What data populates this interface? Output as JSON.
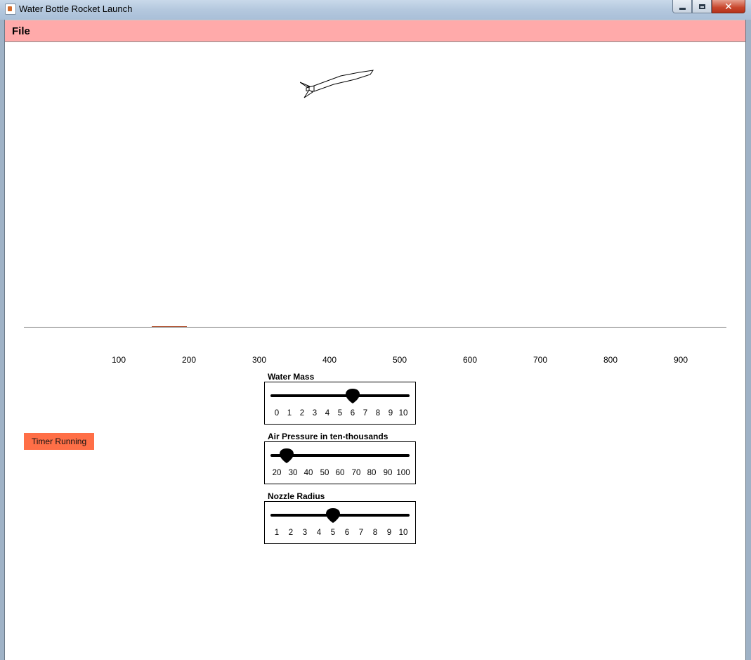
{
  "window": {
    "title": "Water Bottle Rocket Launch"
  },
  "menu": {
    "file_label": "File"
  },
  "axis": {
    "ticks": [
      "100",
      "200",
      "300",
      "400",
      "500",
      "600",
      "700",
      "800",
      "900"
    ]
  },
  "timer": {
    "label": "Timer Running",
    "color": "#ff6f47"
  },
  "sliders": [
    {
      "label": "Water Mass",
      "ticks": [
        "0",
        "1",
        "2",
        "3",
        "4",
        "5",
        "6",
        "7",
        "8",
        "9",
        "10"
      ],
      "value": "6"
    },
    {
      "label": "Air Pressure in ten-thousands",
      "ticks": [
        "20",
        "30",
        "40",
        "50",
        "60",
        "70",
        "80",
        "90",
        "100"
      ],
      "value": "30"
    },
    {
      "label": "Nozzle Radius",
      "ticks": [
        "1",
        "2",
        "3",
        "4",
        "5",
        "6",
        "7",
        "8",
        "9",
        "10"
      ],
      "value": "5"
    }
  ],
  "colors": {
    "menubar": "#ffaaaa",
    "ground_marker": "#b55a3a"
  },
  "icons": [
    "java-app-icon",
    "minimize-icon",
    "maximize-icon",
    "close-icon",
    "rocket-icon",
    "slider-thumb-icon"
  ]
}
